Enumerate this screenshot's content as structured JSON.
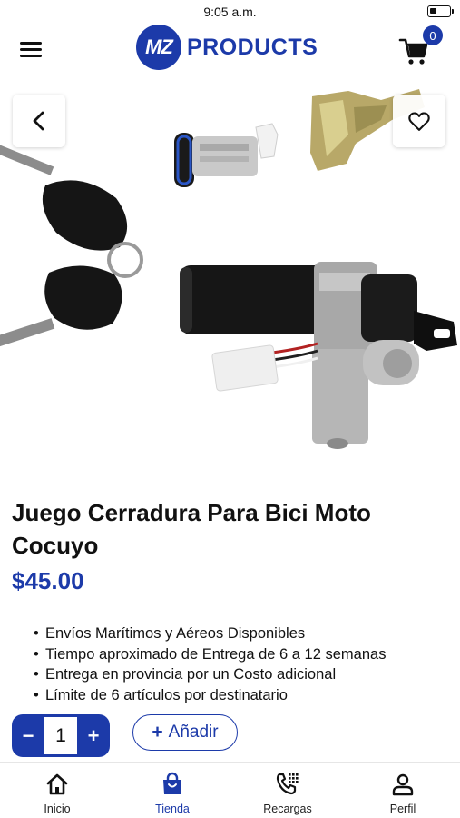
{
  "status_bar": {
    "time": "9:05 a.m.",
    "battery_level": 0.35
  },
  "header": {
    "logo_mark": "MZ",
    "logo_text": "PRODUCTS",
    "cart_count": "0",
    "menu_icon": "hamburger-menu-icon",
    "cart_icon": "shopping-cart-icon"
  },
  "product": {
    "title": "Juego Cerradura Para Bici Moto Cocuyo",
    "price": "$45.00",
    "features": [
      "Envíos  Marítimos y Aéreos Disponibles",
      "Tiempo aproximado de Entrega de 6  a 12 semanas",
      "Entrega en provincia por un Costo adicional",
      "Límite de 6 artículos por destinatario"
    ],
    "quantity": "1",
    "quantity_minus": "−",
    "quantity_plus": "+",
    "add_plus": "+",
    "add_label": "Añadir"
  },
  "bottom_nav": [
    {
      "label": "Inicio",
      "icon": "home-icon",
      "active": false
    },
    {
      "label": "Tienda",
      "icon": "shopping-bag-icon",
      "active": true
    },
    {
      "label": "Recargas",
      "icon": "phone-dialpad-icon",
      "active": false
    },
    {
      "label": "Perfil",
      "icon": "user-icon",
      "active": false
    }
  ],
  "colors": {
    "brand": "#1c3aa9",
    "text": "#111111",
    "background": "#ffffff"
  }
}
